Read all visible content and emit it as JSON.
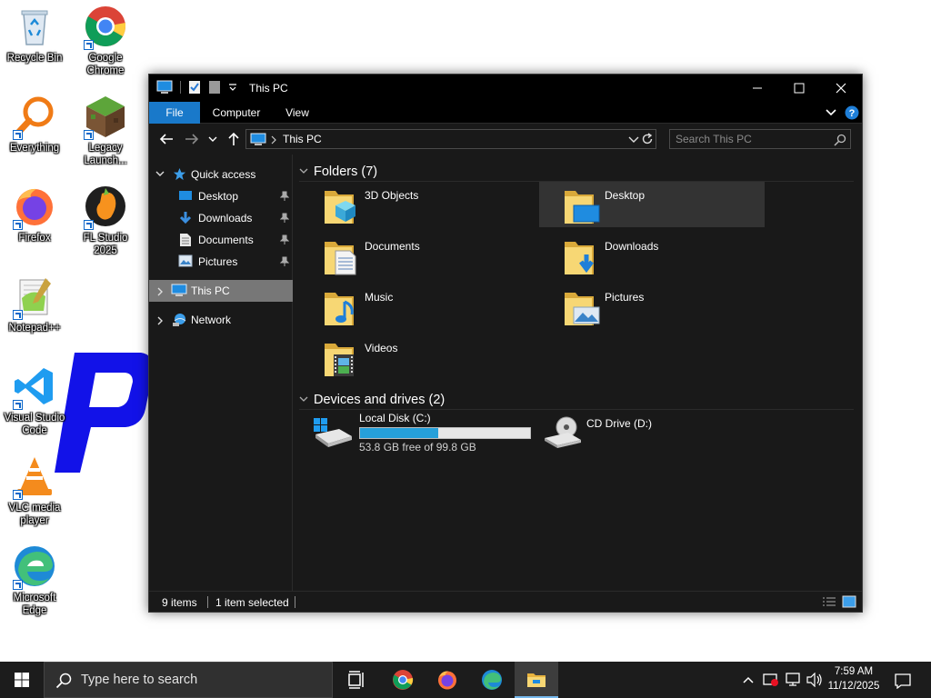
{
  "desktop": {
    "icons": [
      {
        "label": "Recycle Bin",
        "icon": "recycle-bin-icon"
      },
      {
        "label": "Google Chrome",
        "icon": "chrome-icon"
      },
      {
        "label": "Everything",
        "icon": "everything-search-icon"
      },
      {
        "label": "Legacy Launch...",
        "icon": "minecraft-block-icon"
      },
      {
        "label": "Firefox",
        "icon": "firefox-icon"
      },
      {
        "label": "FL Studio 2025",
        "icon": "fl-studio-icon"
      },
      {
        "label": "Notepad++",
        "icon": "notepad-plus-plus-icon"
      },
      {
        "label": "Visual Studio Code",
        "icon": "vscode-icon"
      },
      {
        "label": "VLC media player",
        "icon": "vlc-icon"
      },
      {
        "label": "Microsoft Edge",
        "icon": "edge-icon"
      }
    ]
  },
  "window": {
    "title": "This PC",
    "ribbon_tabs": [
      "File",
      "Computer",
      "View"
    ],
    "address": "This PC",
    "search_placeholder": "Search This PC",
    "accent": "#1979ca"
  },
  "nav": {
    "quick_access": "Quick access",
    "quick_items": [
      {
        "label": "Desktop",
        "icon": "desktop-folder-icon",
        "pinned": true
      },
      {
        "label": "Downloads",
        "icon": "downloads-arrow-icon",
        "pinned": true
      },
      {
        "label": "Documents",
        "icon": "documents-icon",
        "pinned": true
      },
      {
        "label": "Pictures",
        "icon": "pictures-icon",
        "pinned": true
      }
    ],
    "this_pc": "This PC",
    "network": "Network"
  },
  "content": {
    "folders_header": "Folders (7)",
    "folders": [
      {
        "label": "3D Objects",
        "icon": "3d-objects-folder-icon"
      },
      {
        "label": "Desktop",
        "icon": "desktop-folder-icon",
        "selected": true
      },
      {
        "label": "Documents",
        "icon": "documents-folder-icon"
      },
      {
        "label": "Downloads",
        "icon": "downloads-folder-icon"
      },
      {
        "label": "Music",
        "icon": "music-folder-icon"
      },
      {
        "label": "Pictures",
        "icon": "pictures-folder-icon"
      },
      {
        "label": "Videos",
        "icon": "videos-folder-icon"
      }
    ],
    "devices_header": "Devices and drives (2)",
    "drives": [
      {
        "label": "Local Disk (C:)",
        "free_text": "53.8 GB free of 99.8 GB",
        "used_fraction": 0.461,
        "icon": "hard-drive-icon"
      },
      {
        "label": "CD Drive (D:)",
        "icon": "cd-drive-icon"
      }
    ]
  },
  "status": {
    "items": "9 items",
    "selected": "1 item selected"
  },
  "taskbar": {
    "search_placeholder": "Type here to search",
    "apps": [
      "task-view-icon",
      "chrome-icon",
      "firefox-icon",
      "edge-icon",
      "file-explorer-icon"
    ],
    "time": "7:59 AM",
    "date": "11/12/2025"
  }
}
